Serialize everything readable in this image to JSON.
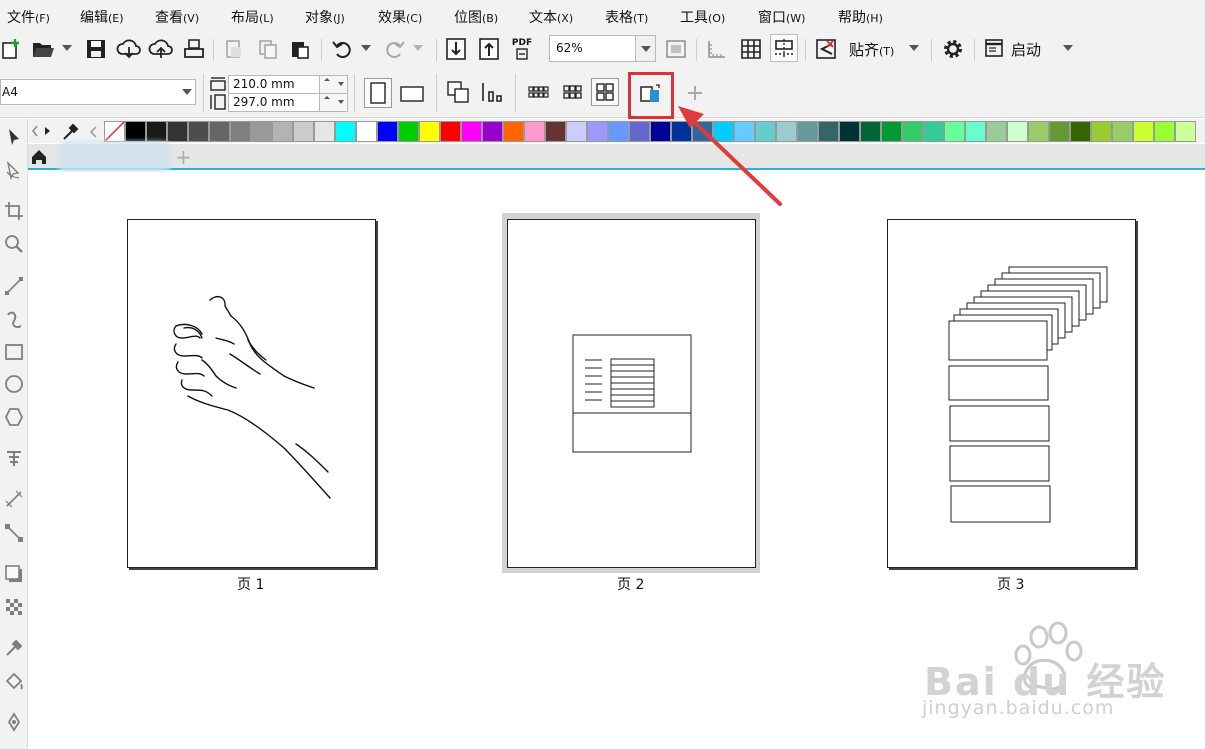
{
  "menu": [
    {
      "label": "文件",
      "hotkey": "(F)"
    },
    {
      "label": "编辑",
      "hotkey": "(E)"
    },
    {
      "label": "查看",
      "hotkey": "(V)"
    },
    {
      "label": "布局",
      "hotkey": "(L)"
    },
    {
      "label": "对象",
      "hotkey": "(J)"
    },
    {
      "label": "效果",
      "hotkey": "(C)"
    },
    {
      "label": "位图",
      "hotkey": "(B)"
    },
    {
      "label": "文本",
      "hotkey": "(X)"
    },
    {
      "label": "表格",
      "hotkey": "(T)"
    },
    {
      "label": "工具",
      "hotkey": "(O)"
    },
    {
      "label": "窗口",
      "hotkey": "(W)"
    },
    {
      "label": "帮助",
      "hotkey": "(H)"
    }
  ],
  "toolbar": {
    "pdf_label": "PDF",
    "zoom_value": "62%",
    "snap_label": "贴齐",
    "snap_hotkey": "(T)",
    "launch_label": "启动"
  },
  "property_bar": {
    "page_size": "A4",
    "width": "210.0 mm",
    "height": "297.0 mm"
  },
  "palette_colors": [
    "#000000",
    "#1a1a1a",
    "#333333",
    "#4d4d4d",
    "#666666",
    "#808080",
    "#999999",
    "#b3b3b3",
    "#cccccc",
    "#e6e6e6",
    "#00ffff",
    "#ffffff",
    "#0000ff",
    "#00cc00",
    "#ffff00",
    "#ff0000",
    "#ff00ff",
    "#9900cc",
    "#ff6600",
    "#ff99cc",
    "#663333",
    "#ccccff",
    "#9999ff",
    "#6699ff",
    "#6666cc",
    "#000099",
    "#003399",
    "#336699",
    "#00ccff",
    "#66ccff",
    "#66cccc",
    "#99cccc",
    "#669999",
    "#336666",
    "#003333",
    "#006633",
    "#009933",
    "#33cc66",
    "#33cc99",
    "#66ff99",
    "#66ffcc",
    "#99cc99",
    "#ccffcc",
    "#99cc66",
    "#669933",
    "#336600",
    "#99cc33",
    "#99cc66",
    "#ccff33",
    "#99ff33",
    "#ccff99"
  ],
  "pages": [
    {
      "label": "页 1"
    },
    {
      "label": "页 2"
    },
    {
      "label": "页 3"
    }
  ],
  "watermark": {
    "brand": "Bai du 经验",
    "url": "jingyan.baidu.com"
  }
}
